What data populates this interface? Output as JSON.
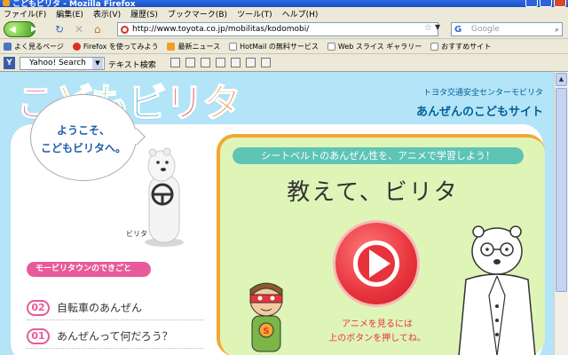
{
  "window": {
    "title": "こどもビリタ - Mozilla Firefox"
  },
  "menu": [
    "ファイル(F)",
    "編集(E)",
    "表示(V)",
    "履歴(S)",
    "ブックマーク(B)",
    "ツール(T)",
    "ヘルプ(H)"
  ],
  "nav": {
    "url": "http://www.toyota.co.jp/mobilitas/kodomobi/",
    "search_placeholder": "Google",
    "search_engine_icon": "G"
  },
  "bookmarks": [
    {
      "label": "よく見るページ",
      "color": "#4a74c8"
    },
    {
      "label": "Firefox を使ってみよう",
      "color": "#d83020"
    },
    {
      "label": "最新ニュース",
      "color": "#f0a020"
    },
    {
      "label": "HotMail の無料サービス",
      "color": "#888888"
    },
    {
      "label": "Web スライス ギャラリー",
      "color": "#888888"
    },
    {
      "label": "おすすめサイト",
      "color": "#888888"
    }
  ],
  "yahoo": {
    "logo": "Y",
    "search_select": "Yahoo! Search",
    "text_search": "テキスト検索"
  },
  "site": {
    "logo_chars": [
      {
        "c": "こ",
        "color": "#e83a80"
      },
      {
        "c": "ど",
        "color": "#f5a623"
      },
      {
        "c": "も",
        "color": "#2eb24a"
      },
      {
        "c": "ビ",
        "color": "#1aa0e0"
      },
      {
        "c": "リ",
        "color": "#e83a3a"
      },
      {
        "c": "タ",
        "color": "#f07a20"
      }
    ],
    "sponsor_line1": "トヨタ交通安全センターモビリタ",
    "sponsor_line2": "あんぜんのこどもサイト",
    "welcome_line1": "ようこそ、",
    "welcome_line2": "こどもビリタへ。",
    "bear_name": "ビリタ",
    "events_title": "モービリタウンのできごと",
    "events": [
      {
        "num": "02",
        "label": "自転車のあんぜん"
      },
      {
        "num": "01",
        "label": "あんぜんって何だろう？"
      }
    ],
    "banner": "シートベルトのあんぜん性を、アニメで学習しよう！",
    "heading": "教えて、ビリタ",
    "caption_line1": "アニメを見るには",
    "caption_line2": "上のボタンを押してね。",
    "hero_badge": "S"
  }
}
